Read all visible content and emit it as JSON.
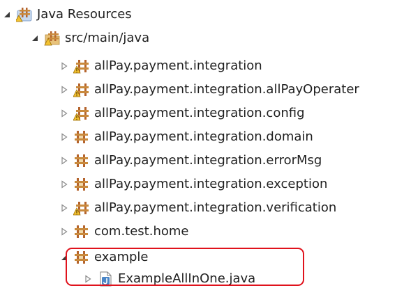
{
  "tree": {
    "project": {
      "label": "Java Resources",
      "icon": "java-resources-icon",
      "state": "expanded"
    },
    "source_folder": {
      "label": "src/main/java",
      "icon": "source-folder-icon",
      "state": "expanded"
    },
    "packages": [
      {
        "label": "allPay.payment.integration",
        "icon": "package-warning-icon",
        "state": "collapsed"
      },
      {
        "label": "allPay.payment.integration.allPayOperater",
        "icon": "package-warning-icon",
        "state": "collapsed"
      },
      {
        "label": "allPay.payment.integration.config",
        "icon": "package-warning-icon",
        "state": "collapsed"
      },
      {
        "label": "allPay.payment.integration.domain",
        "icon": "package-icon",
        "state": "collapsed"
      },
      {
        "label": "allPay.payment.integration.errorMsg",
        "icon": "package-icon",
        "state": "collapsed"
      },
      {
        "label": "allPay.payment.integration.exception",
        "icon": "package-icon",
        "state": "collapsed"
      },
      {
        "label": "allPay.payment.integration.verification",
        "icon": "package-warning-icon",
        "state": "collapsed"
      },
      {
        "label": "com.test.home",
        "icon": "package-icon",
        "state": "collapsed"
      },
      {
        "label": "example",
        "icon": "package-icon",
        "state": "expanded"
      }
    ],
    "files": [
      {
        "label": "ExampleAllInOne.java",
        "icon": "java-file-icon",
        "state": "collapsed"
      }
    ]
  },
  "colors": {
    "package_brown": "#a0522d",
    "package_tan": "#d2a26b",
    "warning_yellow": "#f2c232",
    "java_blue": "#4a86c7",
    "highlight_red": "#e0121c"
  }
}
